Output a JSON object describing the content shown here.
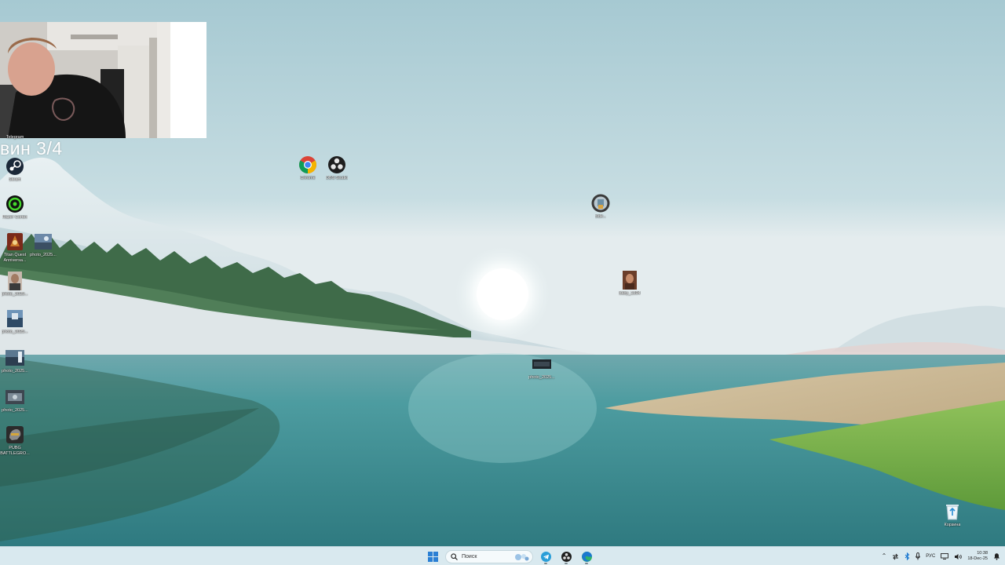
{
  "screen": {
    "overlay_text": "вин 3/4"
  },
  "desktop_icons": [
    {
      "id": "webcam-hidden",
      "label": "Telegram"
    },
    {
      "id": "steam",
      "label": "Steam"
    },
    {
      "id": "razer",
      "label": "Razer Cortex"
    },
    {
      "id": "titan",
      "label": "Titan Quest Anniversa..."
    },
    {
      "id": "photo1",
      "label": "photo_2025..."
    },
    {
      "id": "photo2",
      "label": "photo_2025..."
    },
    {
      "id": "photo3",
      "label": "photo_2025..."
    },
    {
      "id": "photo4",
      "label": "photo_2025..."
    },
    {
      "id": "photo5",
      "label": "photo_2025..."
    },
    {
      "id": "pubg",
      "label": "PUBG BATTLEGRO..."
    },
    {
      "id": "chrome",
      "label": "Chrome"
    },
    {
      "id": "obs",
      "label": "OBS Studio"
    },
    {
      "id": "avatar",
      "label": "olde..."
    },
    {
      "id": "girl",
      "label": "baby_1394"
    },
    {
      "id": "photo-center",
      "label": "photo_2025..."
    },
    {
      "id": "recycle",
      "label": "Корзина"
    }
  ],
  "taskbar": {
    "search_placeholder": "Поиск",
    "language": "РУС",
    "time": "10:38",
    "date": "18-Dec-25"
  },
  "colors": {
    "sky_top": "#a9cbd3",
    "water": "#3f8f94",
    "taskbar_bg": "#d9e9ef",
    "windows_blue": "#2a7fd4"
  },
  "icons": {
    "start": "windows-logo",
    "search": "magnifier",
    "telegram": "paper-plane",
    "obs": "obs-logo",
    "edge": "edge-logo"
  }
}
